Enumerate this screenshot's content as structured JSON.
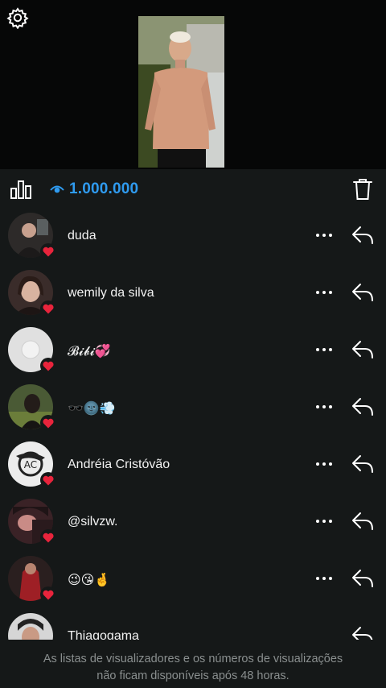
{
  "story": {
    "views_count": "1.000.000"
  },
  "viewers": [
    {
      "name": "duda",
      "avatar_color": "#3b3230"
    },
    {
      "name": "wemily da silva",
      "avatar_color": "#5a4540"
    },
    {
      "name": "𝓑𝓲𝓫𝓲💞",
      "avatar_color": "#d9d9d9"
    },
    {
      "name": "🕶️🌚💨",
      "avatar_color": "#3a4a2f"
    },
    {
      "name": "Andréia Cristóvão",
      "avatar_color": "#e6e6e6"
    },
    {
      "name": "@silvzw.",
      "avatar_color": "#4a2a2e"
    },
    {
      "name": "😉😘🤞",
      "avatar_color": "#6a2a2a"
    },
    {
      "name": "Thiagogama",
      "avatar_color": "#cfcfcf"
    }
  ],
  "footer": {
    "line1": "As listas de visualizadores e os números de visualizações",
    "line2": "não ficam disponíveis após 48 horas."
  },
  "colors": {
    "accent": "#2f9bf0",
    "heart": "#e8243c",
    "background": "#151818"
  },
  "icons": {
    "settings": "gear-icon",
    "insights": "bar-chart-icon",
    "views": "eye-icon",
    "delete": "trash-icon",
    "more": "more-dots-icon",
    "reply": "reply-arrow-icon",
    "heart": "heart-icon"
  }
}
